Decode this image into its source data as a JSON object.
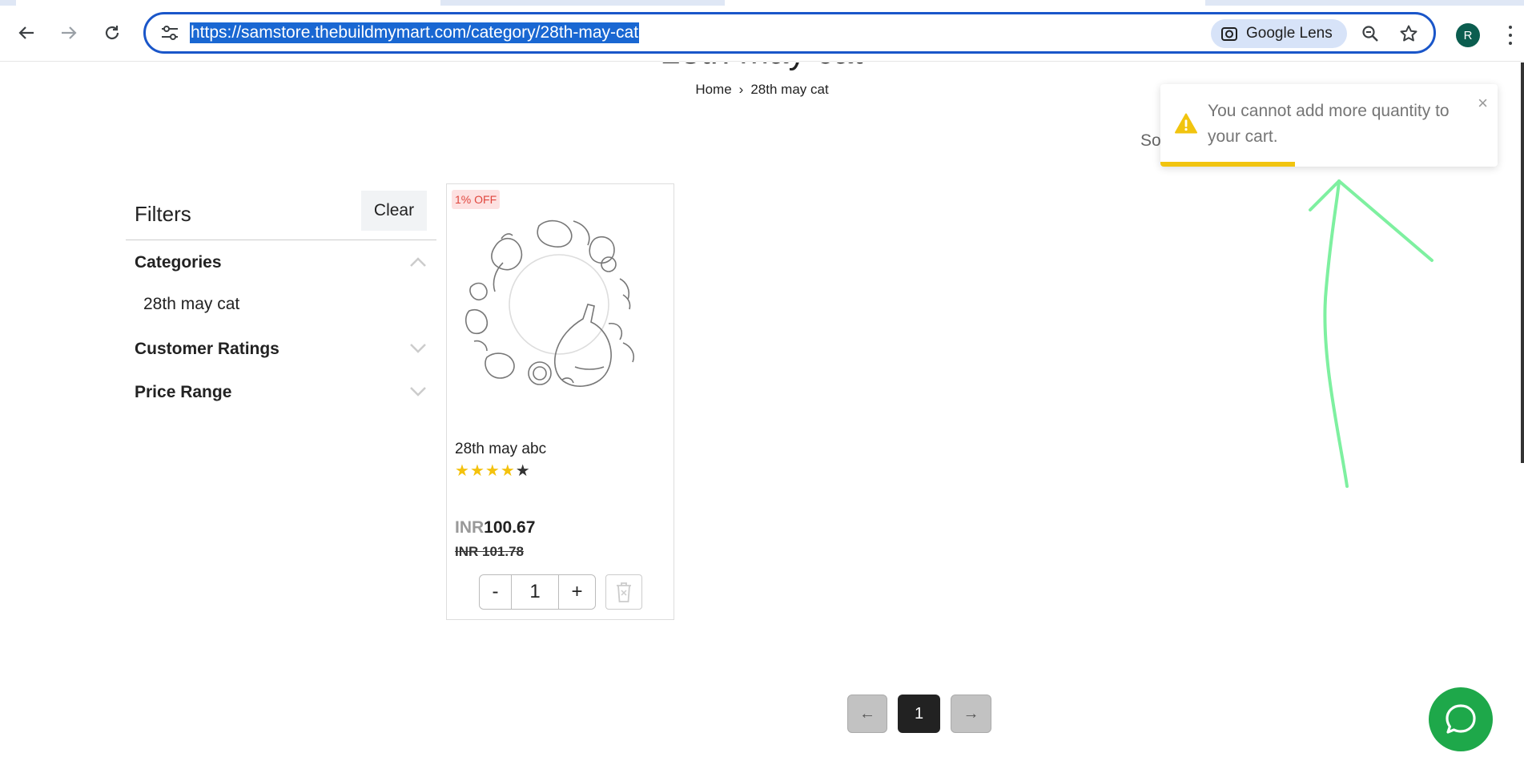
{
  "browser": {
    "url": "https://samstore.thebuildmymart.com/category/28th-may-cat",
    "lens_label": "Google Lens",
    "profile_initial": "R"
  },
  "page": {
    "title": "28th may cat",
    "breadcrumb": {
      "home": "Home",
      "separator": "›",
      "current": "28th may cat"
    },
    "sort_peek": "So"
  },
  "filters": {
    "title": "Filters",
    "clear_label": "Clear",
    "sections": [
      {
        "label": "Categories",
        "expanded": true,
        "options": [
          "28th may cat"
        ]
      },
      {
        "label": "Customer Ratings",
        "expanded": false
      },
      {
        "label": "Price Range",
        "expanded": false
      }
    ]
  },
  "products": [
    {
      "badge": "1% OFF",
      "name": "28th may abc",
      "rating": 4,
      "rating_max": 5,
      "currency": "INR",
      "price": "100.67",
      "mrp": "INR 101.78",
      "quantity": "1",
      "minus_label": "-",
      "plus_label": "+"
    }
  ],
  "pagination": {
    "prev": "←",
    "current": "1",
    "next": "→"
  },
  "toast": {
    "type": "warning",
    "message": "You cannot add more quantity to your cart.",
    "close": "×",
    "progress_fraction": 0.4
  },
  "colors": {
    "accent_blue": "#1a56c9",
    "warning_yellow": "#f1c40f",
    "badge_red": "#e0463d",
    "star_yellow": "#f4c20d",
    "chat_green": "#1ea84a",
    "annotation_green": "#7ef0a0"
  },
  "icons": {
    "back": "arrow-left-icon",
    "forward": "arrow-right-icon",
    "reload": "reload-icon",
    "site_info": "tune-icon",
    "lens": "camera-lens-icon",
    "zoom": "zoom-icon",
    "bookmark": "star-icon",
    "menu": "kebab-icon",
    "delete": "trash-icon",
    "chat": "chat-bubble-icon",
    "warning": "warning-icon"
  }
}
